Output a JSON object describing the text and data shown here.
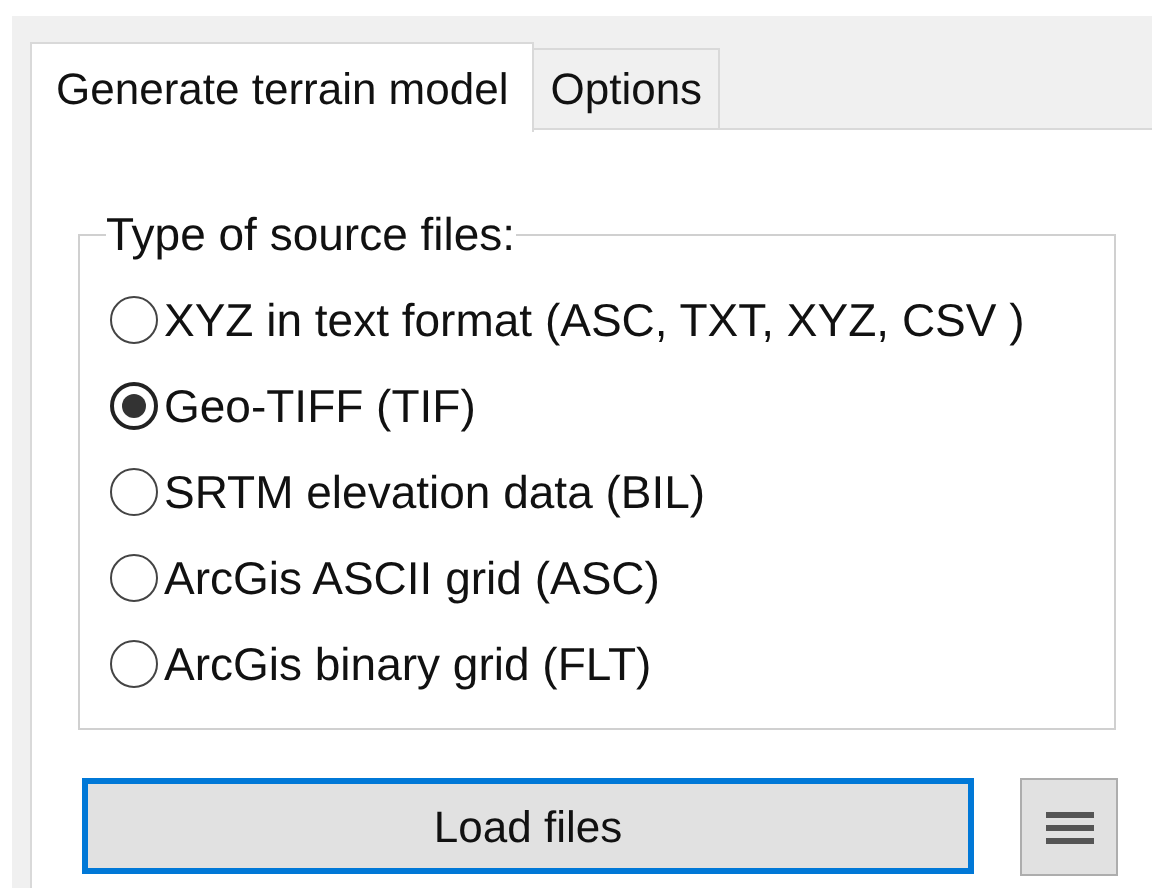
{
  "tabs": [
    {
      "label": "Generate terrain model",
      "selected": true
    },
    {
      "label": "Options",
      "selected": false
    }
  ],
  "source_group": {
    "legend": "Type of source files:",
    "options": [
      {
        "label": "XYZ in text format (ASC, TXT, XYZ, CSV )",
        "selected": false
      },
      {
        "label": "Geo-TIFF (TIF)",
        "selected": true
      },
      {
        "label": "SRTM elevation data (BIL)",
        "selected": false
      },
      {
        "label": "ArcGis ASCII grid (ASC)",
        "selected": false
      },
      {
        "label": "ArcGis binary grid (FLT)",
        "selected": false
      }
    ]
  },
  "load_button": {
    "label": "Load files",
    "focused": true
  }
}
